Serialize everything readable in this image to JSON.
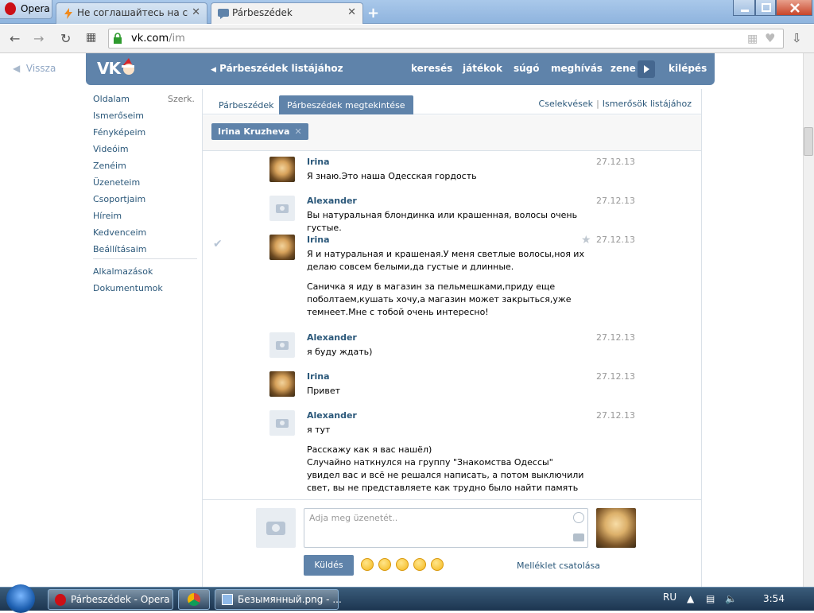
{
  "browser": {
    "menu_label": "Opera",
    "tabs": [
      {
        "title": "Не соглашайтесь на секс",
        "active": false
      },
      {
        "title": "Párbeszédek",
        "active": true
      }
    ],
    "url_host": "vk.com",
    "url_path": "/im"
  },
  "vk": {
    "back_label": "Vissza",
    "logo": "VK",
    "header_links": {
      "dialog_list": "Párbeszédek listájához",
      "search": "keresés",
      "games": "játékok",
      "help": "súgó",
      "invite": "meghívás",
      "music": "zene",
      "logout": "kilépés"
    },
    "sidebar": {
      "edit_label": "Szerk.",
      "items": [
        "Oldalam",
        "Ismerőseim",
        "Fényképeim",
        "Videóim",
        "Zenéim",
        "Üzeneteim",
        "Csoportjaim",
        "Híreim",
        "Kedvenceim",
        "Beállításaim"
      ],
      "extra": [
        "Alkalmazások",
        "Dokumentumok"
      ]
    },
    "tabs": {
      "dialogs": "Párbeszédek",
      "view": "Párbeszédek megtekintése",
      "actions": "Cselekvések",
      "to_friends": "Ismerősök listájához"
    },
    "peer_chip": "Irina Kruzheva",
    "messages": [
      {
        "author": "Irina",
        "date": "27.12.13",
        "avatar": "irina-photo",
        "lines": [
          "Я знаю.Это наша Одесская гордость"
        ]
      },
      {
        "author": "Alexander",
        "date": "27.12.13",
        "avatar": "camera-placeholder",
        "lines": [
          "Вы натуральная блондинка или крашенная, волосы очень густые."
        ]
      },
      {
        "author": "Irina",
        "date": "27.12.13",
        "avatar": "irina-photo",
        "starred": true,
        "lines": [
          "Я и натуральная и крашеная.У меня светлые волосы,ноя их делаю совсем белыми,да густые и длинные.",
          "Саничка я иду в магазин за пельмешками,приду еще поболтаем,кушать хочу,а магазин может закрыться,уже темнеет.Мне с тобой очень интересно!"
        ]
      },
      {
        "author": "Alexander",
        "date": "27.12.13",
        "avatar": "camera-placeholder",
        "lines": [
          "я буду ждать)"
        ]
      },
      {
        "author": "Irina",
        "date": "27.12.13",
        "avatar": "irina-photo",
        "lines": [
          "Привет"
        ]
      },
      {
        "author": "Alexander",
        "date": "27.12.13",
        "avatar": "camera-placeholder",
        "lines": [
          "я тут",
          "Расскажу как я вас нашёл)\nСлучайно наткнулся на группу \"Знакомства Одессы\" увидел вас и всё не решался написать, а потом выключили свет, вы не представляете как трудно было найти память у меня куриная на"
        ]
      }
    ],
    "composer": {
      "placeholder": "Adja meg üzenetét..",
      "send_label": "Küldés",
      "attach_label": "Melléklet csatolása"
    }
  },
  "taskbar": {
    "items": [
      "Párbeszédek - Opera",
      "Безымянный.png - ..."
    ],
    "lang": "RU",
    "clock": "3:54"
  },
  "colors": {
    "vk_blue": "#5f83aa",
    "link": "#2b587a",
    "opera_red": "#cc0f16"
  }
}
